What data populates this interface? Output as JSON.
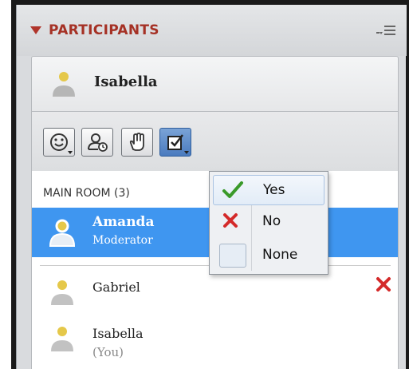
{
  "panel": {
    "title": "PARTICIPANTS"
  },
  "self": {
    "name": "Isabella"
  },
  "toolbar": {
    "buttons": [
      {
        "icon": "emoticon-icon"
      },
      {
        "icon": "away-user-icon"
      },
      {
        "icon": "raise-hand-icon"
      },
      {
        "icon": "checkbox-vote-icon"
      }
    ]
  },
  "room": {
    "label": "MAIN ROOM (3)"
  },
  "participants": [
    {
      "name": "Amanda",
      "role": "Moderator"
    },
    {
      "name": "Gabriel"
    },
    {
      "name": "Isabella",
      "sub": "(You)"
    }
  ],
  "vote_menu": {
    "options": [
      {
        "label": "Yes"
      },
      {
        "label": "No"
      },
      {
        "label": "None"
      }
    ]
  },
  "colors": {
    "accent": "#a53125",
    "selection": "#3f96f0",
    "check": "#3a9a2a",
    "cross": "#d42a2a"
  }
}
